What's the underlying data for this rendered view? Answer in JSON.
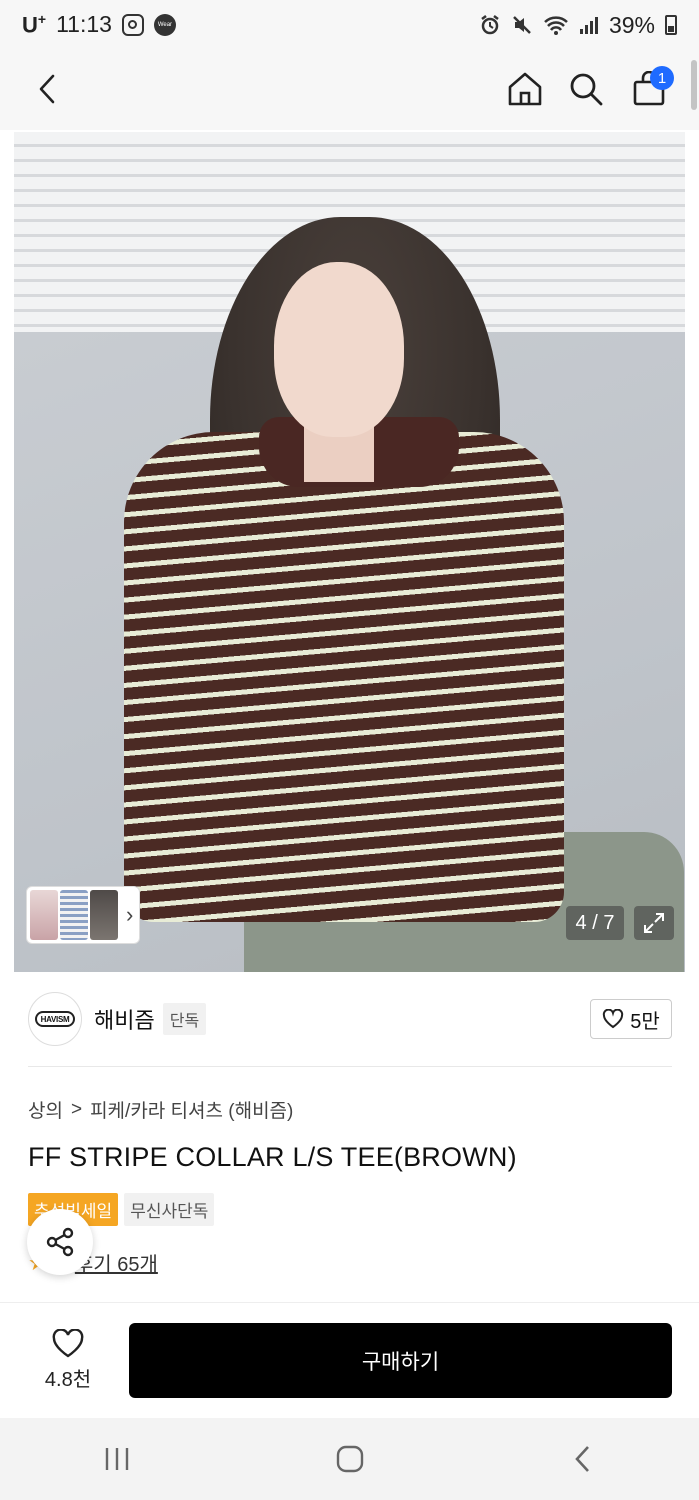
{
  "status_bar": {
    "carrier": "U",
    "carrier_sup": "+",
    "time": "11:13",
    "wear_label": "Wear",
    "battery": "39%"
  },
  "nav": {
    "cart_count": "1"
  },
  "gallery": {
    "counter": "4 / 7"
  },
  "brand": {
    "logo_text": "HAVISM",
    "name": "해비즘",
    "tag": "단독",
    "likes": "5만"
  },
  "breadcrumb": {
    "category": "상의",
    "separator": ">",
    "subcategory": "피케/카라 티셔츠 (해비즘)"
  },
  "product": {
    "title": "FF STRIPE COLLAR L/S TEE(BROWN)",
    "tags": [
      "추석빅세일",
      "무신사단독"
    ],
    "rating_partial": "5",
    "review_link": "후기 65개"
  },
  "purchase_bar": {
    "wish_count": "4.8천",
    "buy_label": "구매하기"
  },
  "colors": {
    "accent_blue": "#1f6bff",
    "sale_orange": "#f5a623",
    "buy_black": "#000000"
  }
}
